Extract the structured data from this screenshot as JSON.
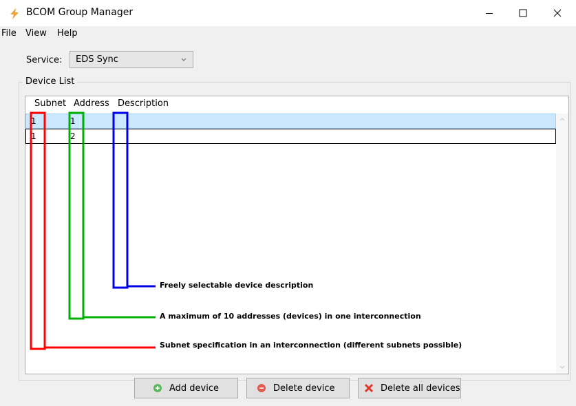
{
  "window": {
    "title": "BCOM Group Manager"
  },
  "menu": {
    "items": [
      "File",
      "View",
      "Help"
    ]
  },
  "service": {
    "label": "Service:",
    "value": "EDS Sync"
  },
  "device_list": {
    "group_label": "Device List",
    "columns": [
      "Subnet",
      "Address",
      "Description"
    ],
    "rows": [
      {
        "subnet": "1",
        "address": "1",
        "description": ""
      },
      {
        "subnet": "1",
        "address": "2",
        "description": ""
      }
    ]
  },
  "annotations": {
    "description": "Freely selectable device description",
    "address": "A maximum of 10 addresses (devices) in one interconnection",
    "subnet": "Subnet specification in an interconnection (different subnets possible)"
  },
  "buttons": {
    "add": "Add device",
    "delete": "Delete device",
    "delete_all": "Delete all devices"
  },
  "colors": {
    "subnet_marker": "#ff0000",
    "address_marker": "#00b000",
    "description_marker": "#0000e6",
    "selection": "#cce8ff"
  }
}
